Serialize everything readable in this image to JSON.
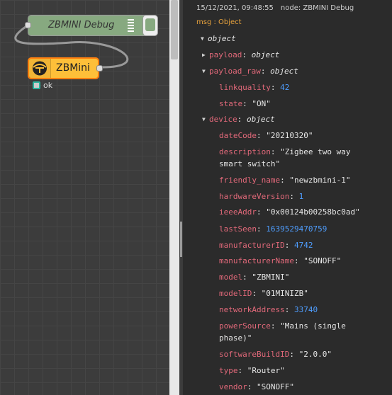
{
  "flow": {
    "debug_node": {
      "label": "ZBMINI Debug"
    },
    "zbmini_node": {
      "label": "ZBMini"
    },
    "status": {
      "text": "ok"
    }
  },
  "debug": {
    "timestamp": "15/12/2021, 09:48:55",
    "node_ref": "node: ZBMINI Debug",
    "msg_label": "msg : Object",
    "root_type": "object",
    "payload_key": "payload",
    "payload_type": "object",
    "payload_raw_key": "payload_raw",
    "payload_raw_type": "object",
    "linkquality_key": "linkquality",
    "linkquality_val": "42",
    "state_key": "state",
    "state_val": "\"ON\"",
    "device_key": "device",
    "device_type": "object",
    "fields": [
      {
        "key": "dateCode",
        "val": "\"20210320\"",
        "kind": "str"
      },
      {
        "key": "description",
        "val": "\"Zigbee two way",
        "val2": "smart switch\"",
        "kind": "str"
      },
      {
        "key": "friendly_name",
        "val": "\"newzbmini-1\"",
        "kind": "str"
      },
      {
        "key": "hardwareVersion",
        "val": "1",
        "kind": "num"
      },
      {
        "key": "ieeeAddr",
        "val": "\"0x00124b00258bc0ad\"",
        "kind": "str"
      },
      {
        "key": "lastSeen",
        "val": "1639529470759",
        "kind": "num"
      },
      {
        "key": "manufacturerID",
        "val": "4742",
        "kind": "num"
      },
      {
        "key": "manufacturerName",
        "val": "\"SONOFF\"",
        "kind": "str"
      },
      {
        "key": "model",
        "val": "\"ZBMINI\"",
        "kind": "str"
      },
      {
        "key": "modelID",
        "val": "\"01MINIZB\"",
        "kind": "str"
      },
      {
        "key": "networkAddress",
        "val": "33740",
        "kind": "num"
      },
      {
        "key": "powerSource",
        "val": "\"Mains (single",
        "val2": "phase)\"",
        "kind": "str"
      },
      {
        "key": "softwareBuildID",
        "val": "\"2.0.0\"",
        "kind": "str"
      },
      {
        "key": "type",
        "val": "\"Router\"",
        "kind": "str"
      },
      {
        "key": "vendor",
        "val": "\"SONOFF\"",
        "kind": "str"
      }
    ]
  },
  "colors": {
    "debug_node": "#87a980",
    "zbmini_node": "#fdbf39",
    "selected_border": "#ff7f0e",
    "key": "#e2697a",
    "number": "#4f9eff",
    "topic": "#e8a33d"
  }
}
